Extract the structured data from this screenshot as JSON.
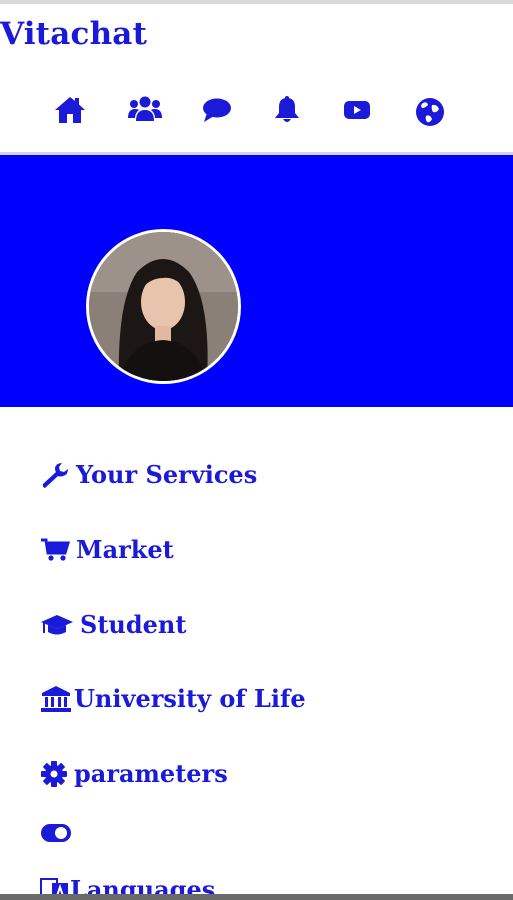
{
  "app": {
    "title": "Vitachat"
  },
  "nav": {
    "items": [
      {
        "icon": "home-icon"
      },
      {
        "icon": "users-icon"
      },
      {
        "icon": "chat-icon"
      },
      {
        "icon": "bell-icon"
      },
      {
        "icon": "youtube-icon"
      },
      {
        "icon": "globe-icon"
      }
    ]
  },
  "colors": {
    "accent": "#1a1ad8",
    "banner": "#0000ff",
    "background": "#ffffff"
  },
  "menu": {
    "items": [
      {
        "icon": "wrench-icon",
        "label": "Your Services"
      },
      {
        "icon": "cart-icon",
        "label": "Market"
      },
      {
        "icon": "graduation-cap-icon",
        "label": "Student"
      },
      {
        "icon": "university-icon",
        "label": "University of Life"
      },
      {
        "icon": "gear-icon",
        "label": "parameters"
      },
      {
        "icon": "toggle-icon",
        "label": ""
      },
      {
        "icon": "language-icon",
        "label": "Languages"
      }
    ]
  }
}
